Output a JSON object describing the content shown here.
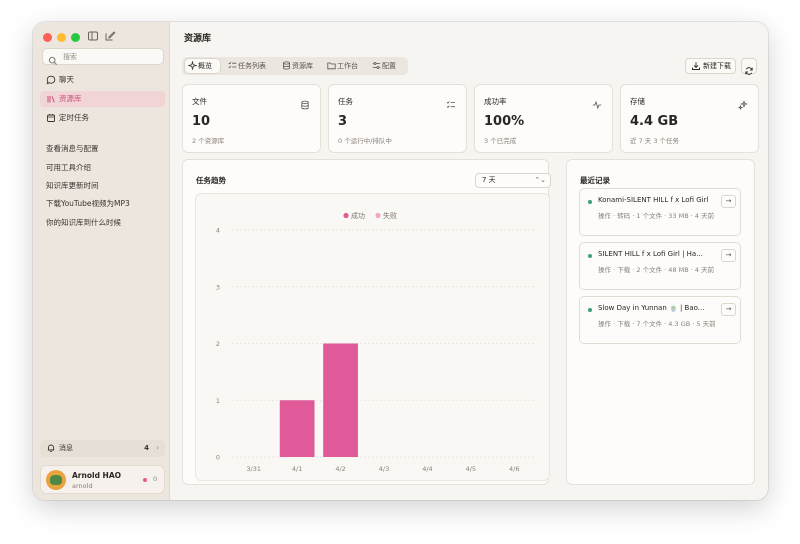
{
  "sidebar": {
    "search_placeholder": "搜索",
    "nav": [
      {
        "label": "聊天",
        "icon": "chat-bubble-icon"
      },
      {
        "label": "资源库",
        "icon": "library-icon"
      },
      {
        "label": "定时任务",
        "icon": "calendar-icon"
      }
    ],
    "history": [
      "查看消息与配置",
      "可用工具介绍",
      "知识库更新时间",
      "下载YouTube视频为MP3",
      "你的知识库到什么时候"
    ],
    "messages": {
      "label": "消息",
      "count": "4",
      "chevron": "›"
    },
    "user": {
      "name": "Arnold HAO",
      "handle": "arnold",
      "badge": "0"
    }
  },
  "header": {
    "title": "资源库"
  },
  "tabs": [
    {
      "label": "概览",
      "icon": "sparkle-icon"
    },
    {
      "label": "任务列表",
      "icon": "checklist-icon"
    },
    {
      "label": "资源库",
      "icon": "database-icon"
    },
    {
      "label": "工作台",
      "icon": "folder-icon"
    },
    {
      "label": "配置",
      "icon": "settings-sliders-icon"
    }
  ],
  "actions": {
    "new_download": "新建下载"
  },
  "stats": [
    {
      "label": "文件",
      "value": "10",
      "sub": "2 个资源库",
      "icon": "database-icon"
    },
    {
      "label": "任务",
      "value": "3",
      "sub": "0 个运行中/排队中",
      "icon": "checklist-icon"
    },
    {
      "label": "成功率",
      "value": "100%",
      "sub": "3 个已完成",
      "icon": "pulse-icon"
    },
    {
      "label": "存储",
      "value": "4.4 GB",
      "sub": "近 7 天 3 个任务",
      "icon": "sparkle-icon"
    }
  ],
  "trend": {
    "title": "任务趋势",
    "range": "7 天",
    "range_chevron": "⌃⌄"
  },
  "chart_data": {
    "type": "bar",
    "categories": [
      "3/31",
      "4/1",
      "4/2",
      "4/3",
      "4/4",
      "4/5",
      "4/6"
    ],
    "series": [
      {
        "name": "成功",
        "values": [
          0,
          1,
          2,
          0,
          0,
          0,
          0
        ],
        "color": "#e05a9a"
      },
      {
        "name": "失败",
        "values": [
          0,
          0,
          0,
          0,
          0,
          0,
          0
        ],
        "color": "#f0a7c4"
      }
    ],
    "yticks": [
      "0",
      "1",
      "2",
      "3",
      "4"
    ],
    "ylim": [
      0,
      4
    ],
    "grid": true,
    "legend": "top-center"
  },
  "recent": {
    "title": "最近记录",
    "items": [
      {
        "title": "Konami-SILENT HILL f x Lofi Girl",
        "meta": "操作 · 转码 · 1 个文件 · 33 MB · 4 天前",
        "arrow": "→"
      },
      {
        "title": "SILENT HILL f x Lofi Girl | Ha...",
        "meta": "操作 · 下载 · 2 个文件 · 48 MB · 4 天前",
        "arrow": "→"
      },
      {
        "title": "Slow Day in Yunnan 🍵 | Bao...",
        "meta": "操作 · 下载 · 7 个文件 · 4.3 GB · 5 天前",
        "arrow": "→"
      }
    ]
  }
}
